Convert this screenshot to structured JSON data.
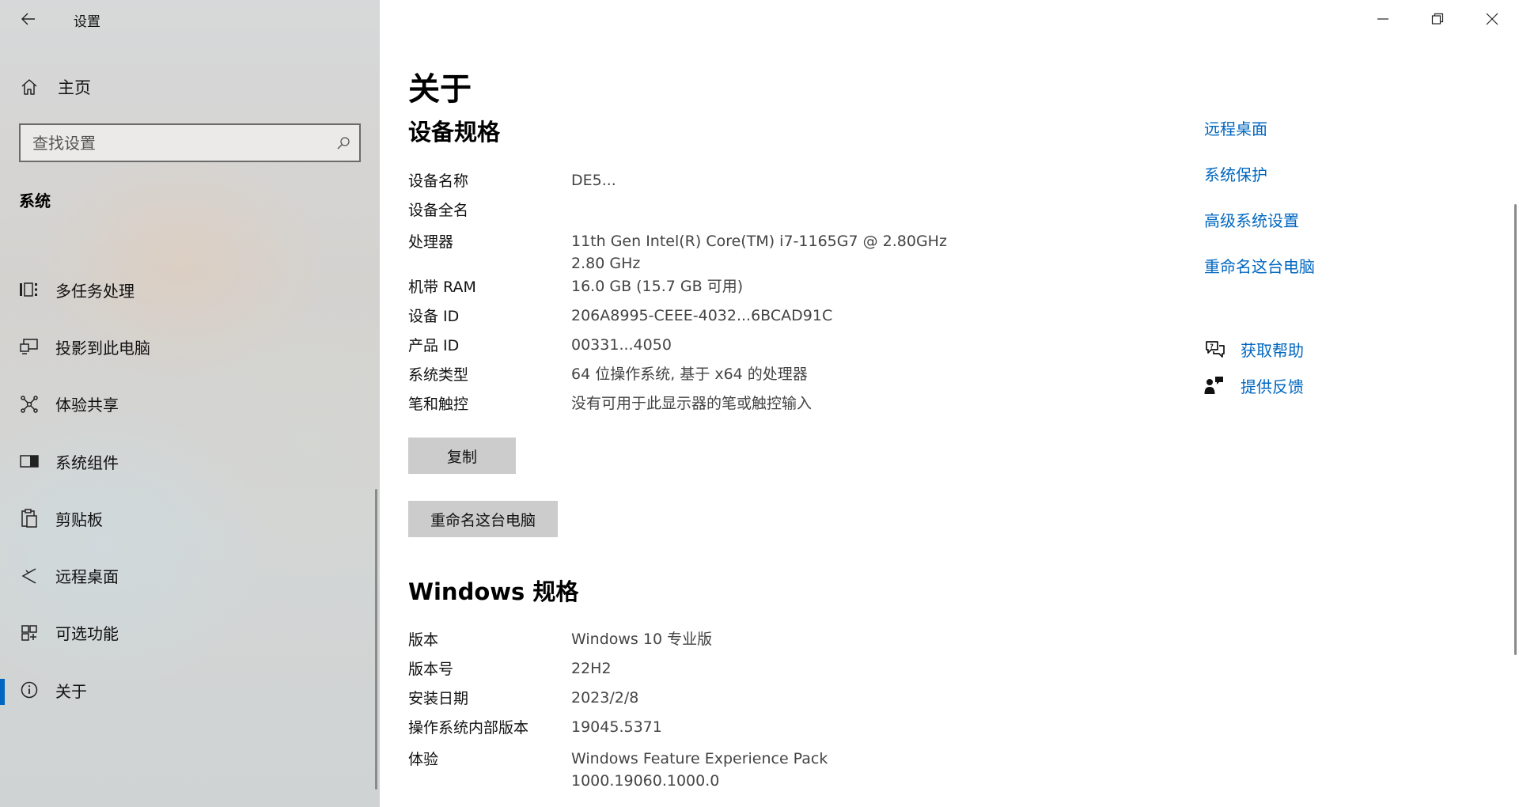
{
  "window": {
    "app_title": "设置",
    "controls": [
      "minimize-icon",
      "restore-icon",
      "close-icon"
    ]
  },
  "sidebar": {
    "home_label": "主页",
    "search_placeholder": "查找设置",
    "section_title": "系统",
    "items": [
      {
        "label": "多任务处理",
        "icon": "multitasking-icon"
      },
      {
        "label": "投影到此电脑",
        "icon": "project-icon"
      },
      {
        "label": "体验共享",
        "icon": "shared-experiences-icon"
      },
      {
        "label": "系统组件",
        "icon": "system-components-icon"
      },
      {
        "label": "剪贴板",
        "icon": "clipboard-icon"
      },
      {
        "label": "远程桌面",
        "icon": "remote-desktop-icon"
      },
      {
        "label": "可选功能",
        "icon": "optional-features-icon"
      },
      {
        "label": "关于",
        "icon": "info-icon",
        "active": true
      }
    ]
  },
  "main": {
    "page_title": "关于",
    "device_specs": {
      "heading": "设备规格",
      "rows": [
        {
          "label": "设备名称",
          "value": "DE5..."
        },
        {
          "label": "设备全名",
          "value": ""
        },
        {
          "label": "处理器",
          "value": "11th Gen Intel(R) Core(TM) i7-1165G7 @ 2.80GHz",
          "value2": "2.80 GHz"
        },
        {
          "label": "机带 RAM",
          "value": "16.0 GB (15.7 GB 可用)"
        },
        {
          "label": "设备 ID",
          "value": "206A8995-CEEE-4032...6BCAD91C"
        },
        {
          "label": "产品 ID",
          "value": "00331...4050"
        },
        {
          "label": "系统类型",
          "value": "64 位操作系统, 基于 x64 的处理器"
        },
        {
          "label": "笔和触控",
          "value": "没有可用于此显示器的笔或触控输入"
        }
      ],
      "copy_button": "复制",
      "rename_button": "重命名这台电脑"
    },
    "windows_specs": {
      "heading": "Windows 规格",
      "rows": [
        {
          "label": "版本",
          "value": "Windows 10 专业版"
        },
        {
          "label": "版本号",
          "value": "22H2"
        },
        {
          "label": "安装日期",
          "value": "2023/2/8"
        },
        {
          "label": "操作系统内部版本",
          "value": "19045.5371"
        },
        {
          "label": "体验",
          "value": "Windows Feature Experience Pack",
          "value2": "1000.19060.1000.0"
        }
      ]
    },
    "related_links": [
      "远程桌面",
      "系统保护",
      "高级系统设置",
      "重命名这台电脑"
    ],
    "help_links": [
      {
        "label": "获取帮助",
        "icon": "get-help-icon"
      },
      {
        "label": "提供反馈",
        "icon": "feedback-icon"
      }
    ]
  },
  "colors": {
    "accent": "#0067c0",
    "button_bg": "#cccccc",
    "sidebar_bg": "#d5d6d6"
  }
}
